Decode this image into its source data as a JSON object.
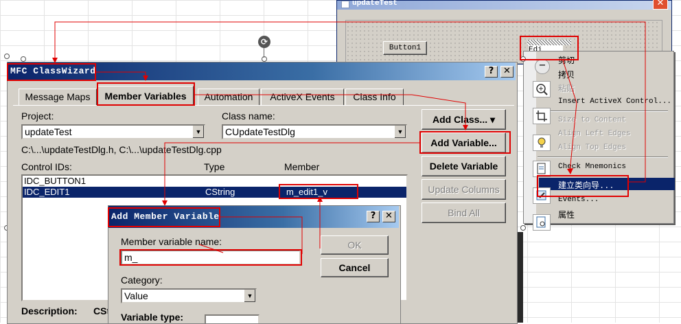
{
  "background_window": {
    "title": "updateTest",
    "close_glyph": "✕",
    "button1_label": "Button1",
    "edit_label": "Edi"
  },
  "context_menu": {
    "items": [
      {
        "label": "剪切",
        "enabled": true
      },
      {
        "label": "拷贝",
        "enabled": true
      },
      {
        "label": "粘贴",
        "enabled": false
      },
      {
        "label": "Insert ActiveX Control...",
        "enabled": true
      },
      {
        "label": "Size to Content",
        "enabled": false
      },
      {
        "label": "Align Left Edges",
        "enabled": false
      },
      {
        "label": "Align Top Edges",
        "enabled": false
      },
      {
        "label": "Check Mnemonics",
        "enabled": true
      },
      {
        "label": "建立类向导...",
        "enabled": true,
        "selected": true
      },
      {
        "label": "Events...",
        "enabled": true
      },
      {
        "label": "属性",
        "enabled": true
      }
    ]
  },
  "classwizard": {
    "title": "MFC ClassWizard",
    "help_glyph": "?",
    "close_glyph": "✕",
    "tabs": [
      "Message Maps",
      "Member Variables",
      "Automation",
      "ActiveX Events",
      "Class Info"
    ],
    "active_tab": "Member Variables",
    "project_label": "Project:",
    "project_value": "updateTest",
    "class_name_label": "Class name:",
    "class_name_value": "CUpdateTestDlg",
    "files_path": "C:\\...\\updateTestDlg.h, C:\\...\\updateTestDlg.cpp",
    "columns": {
      "ids": "Control IDs:",
      "type": "Type",
      "member": "Member"
    },
    "rows": [
      {
        "id": "IDC_BUTTON1",
        "type": "",
        "member": ""
      },
      {
        "id": "IDC_EDIT1",
        "type": "CString",
        "member": "m_edit1_v"
      }
    ],
    "buttons": {
      "add_class": "Add Class...",
      "add_variable": "Add Variable...",
      "delete_variable": "Delete Variable",
      "update_columns": "Update Columns",
      "bind_all": "Bind All"
    },
    "description_label": "Description:",
    "description_value": "CSt"
  },
  "add_member_dialog": {
    "title": "Add Member Variable",
    "help_glyph": "?",
    "close_glyph": "✕",
    "member_name_label": "Member variable name:",
    "member_name_value": "m_",
    "ok_label": "OK",
    "cancel_label": "Cancel",
    "category_label": "Category:",
    "category_value": "Value",
    "variable_type_label": "Variable type:"
  },
  "colors": {
    "highlight": "#e00000",
    "selection": "#0a246a",
    "title_active": "#0a246a"
  }
}
